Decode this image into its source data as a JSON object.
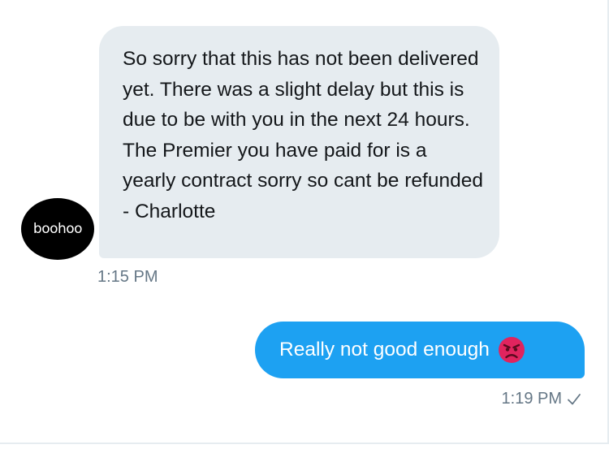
{
  "conversation": {
    "avatar_text": "boohoo",
    "received": {
      "text": "So sorry that this has not been delivered yet. There was a slight delay but this is due to be with you in the next 24 hours. The Premier you have paid for is a yearly contract sorry so cant be refunded - Charlotte",
      "time": "1:15 PM"
    },
    "sent": {
      "text": "Really not good enough",
      "emoji": "angry-face",
      "time": "1:19 PM",
      "status_icon": "checkmark-icon"
    }
  },
  "colors": {
    "received_bubble": "#e6ecf0",
    "sent_bubble": "#1da1f2",
    "timestamp": "#657786",
    "text_dark": "#14171a"
  }
}
